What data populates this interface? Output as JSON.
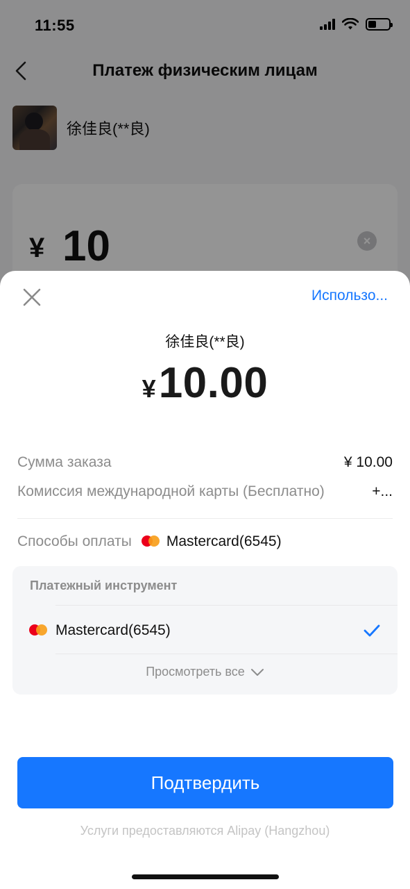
{
  "status_bar": {
    "time": "11:55"
  },
  "background": {
    "title": "Платеж физическим лицам",
    "payee_name": "徐佳良(**良)",
    "amount_currency": "¥",
    "amount_value": "10"
  },
  "sheet": {
    "use_link": "Использо...",
    "payee_name": "徐佳良(**良)",
    "amount_currency": "¥",
    "amount_value": "10.00",
    "order_label": "Сумма заказа",
    "order_value": "¥ 10.00",
    "fee_label": "Комиссия международной карты (Бесплатно)",
    "fee_value": "+...",
    "pay_method_label": "Способы оплаты",
    "pay_method_value": "Mastercard(6545)",
    "instrument_title": "Платежный инструмент",
    "instrument_item": "Mastercard(6545)",
    "view_all": "Просмотреть все",
    "confirm_label": "Подтвердить",
    "footer_note": "Услуги предоставляются Alipay (Hangzhou)"
  },
  "colors": {
    "accent": "#1677ff",
    "mastercard_red": "#eb001b",
    "mastercard_orange": "#f79e1b"
  },
  "icons": [
    "back-arrow-icon",
    "close-icon",
    "clear-icon",
    "mastercard-icon",
    "checkmark-icon",
    "chevron-down-icon",
    "signal-icon",
    "wifi-icon",
    "battery-icon"
  ]
}
